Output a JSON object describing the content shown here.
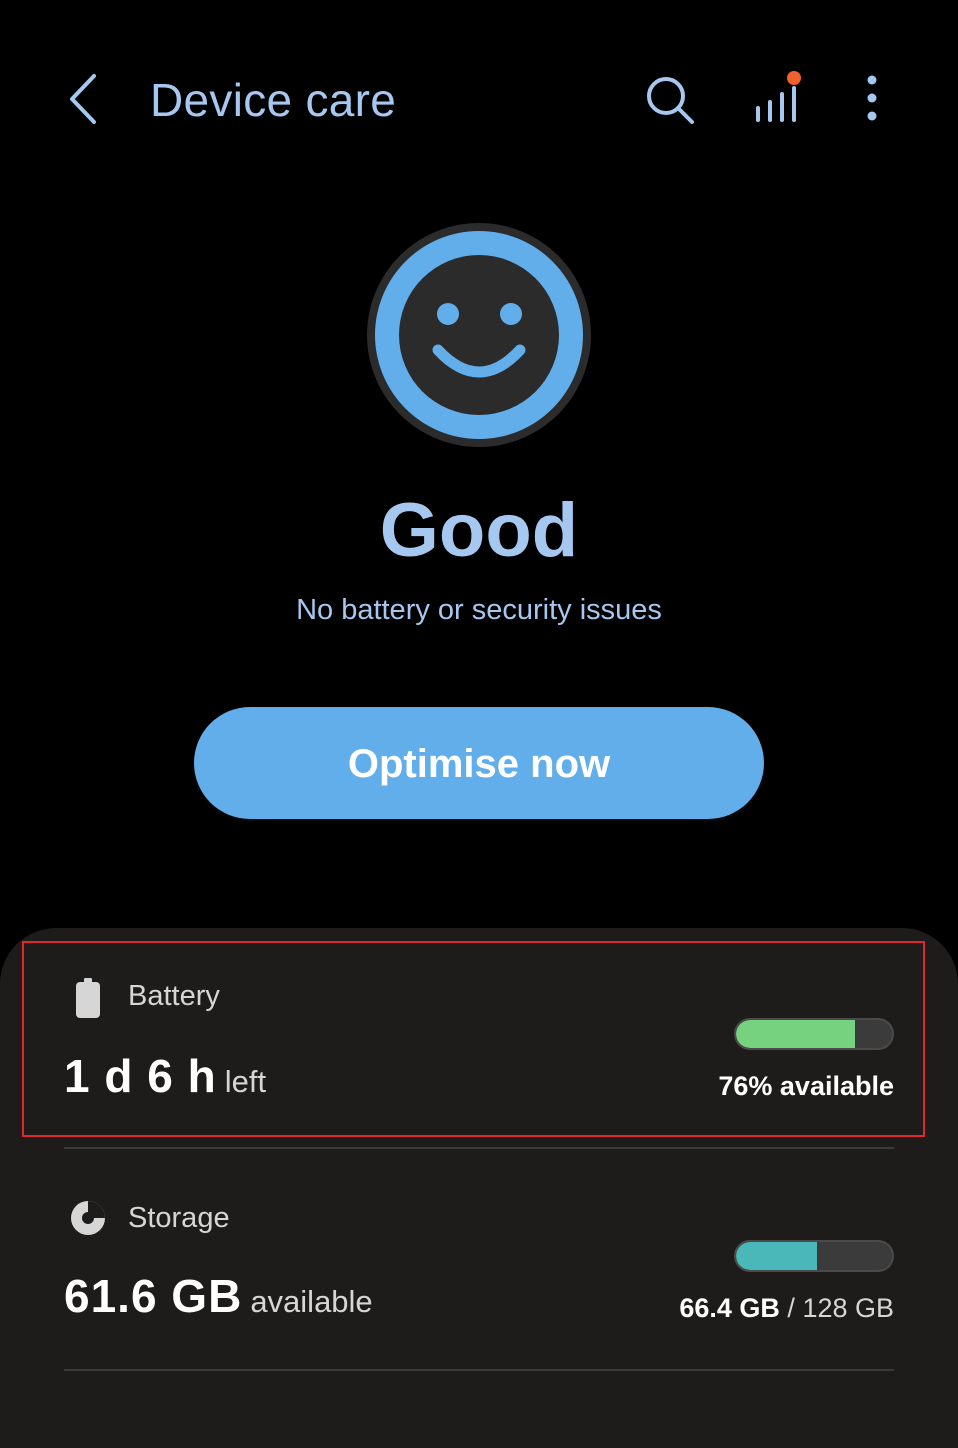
{
  "header": {
    "back_icon": "chevron-left-icon",
    "title": "Device care",
    "search_icon": "search-icon",
    "stats_icon": "signal-bars-icon",
    "notification_dot_color": "#f0612c",
    "more_icon": "more-vertical-icon"
  },
  "status": {
    "icon": "smiley-face-icon",
    "label": "Good",
    "message": "No battery or security issues",
    "accent_color": "#a6c8f0"
  },
  "optimise": {
    "label": "Optimise now",
    "color": "#62aeea"
  },
  "battery": {
    "icon": "battery-icon",
    "label": "Battery",
    "value": "1 d 6 h",
    "unit": "left",
    "level_fraction": 0.76,
    "bar_color": "#76d27f",
    "available_text": "76% available"
  },
  "storage": {
    "icon": "pie-chart-icon",
    "label": "Storage",
    "value": "61.6 GB",
    "unit": "available",
    "used_fraction": 0.52,
    "bar_color": "#4ab7b9",
    "used": "66.4 GB",
    "separator": "/",
    "total": "128 GB"
  }
}
